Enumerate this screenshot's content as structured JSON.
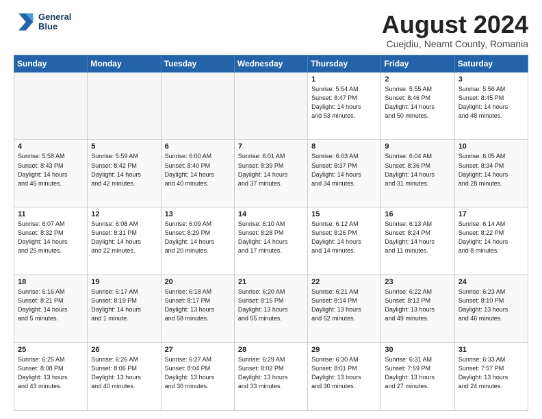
{
  "header": {
    "logo_line1": "General",
    "logo_line2": "Blue",
    "month": "August 2024",
    "location": "Cuejdiu, Neamt County, Romania"
  },
  "weekdays": [
    "Sunday",
    "Monday",
    "Tuesday",
    "Wednesday",
    "Thursday",
    "Friday",
    "Saturday"
  ],
  "weeks": [
    [
      {
        "day": "",
        "info": ""
      },
      {
        "day": "",
        "info": ""
      },
      {
        "day": "",
        "info": ""
      },
      {
        "day": "",
        "info": ""
      },
      {
        "day": "1",
        "info": "Sunrise: 5:54 AM\nSunset: 8:47 PM\nDaylight: 14 hours\nand 53 minutes."
      },
      {
        "day": "2",
        "info": "Sunrise: 5:55 AM\nSunset: 8:46 PM\nDaylight: 14 hours\nand 50 minutes."
      },
      {
        "day": "3",
        "info": "Sunrise: 5:56 AM\nSunset: 8:45 PM\nDaylight: 14 hours\nand 48 minutes."
      }
    ],
    [
      {
        "day": "4",
        "info": "Sunrise: 5:58 AM\nSunset: 8:43 PM\nDaylight: 14 hours\nand 45 minutes."
      },
      {
        "day": "5",
        "info": "Sunrise: 5:59 AM\nSunset: 8:42 PM\nDaylight: 14 hours\nand 42 minutes."
      },
      {
        "day": "6",
        "info": "Sunrise: 6:00 AM\nSunset: 8:40 PM\nDaylight: 14 hours\nand 40 minutes."
      },
      {
        "day": "7",
        "info": "Sunrise: 6:01 AM\nSunset: 8:39 PM\nDaylight: 14 hours\nand 37 minutes."
      },
      {
        "day": "8",
        "info": "Sunrise: 6:03 AM\nSunset: 8:37 PM\nDaylight: 14 hours\nand 34 minutes."
      },
      {
        "day": "9",
        "info": "Sunrise: 6:04 AM\nSunset: 8:36 PM\nDaylight: 14 hours\nand 31 minutes."
      },
      {
        "day": "10",
        "info": "Sunrise: 6:05 AM\nSunset: 8:34 PM\nDaylight: 14 hours\nand 28 minutes."
      }
    ],
    [
      {
        "day": "11",
        "info": "Sunrise: 6:07 AM\nSunset: 8:32 PM\nDaylight: 14 hours\nand 25 minutes."
      },
      {
        "day": "12",
        "info": "Sunrise: 6:08 AM\nSunset: 8:31 PM\nDaylight: 14 hours\nand 22 minutes."
      },
      {
        "day": "13",
        "info": "Sunrise: 6:09 AM\nSunset: 8:29 PM\nDaylight: 14 hours\nand 20 minutes."
      },
      {
        "day": "14",
        "info": "Sunrise: 6:10 AM\nSunset: 8:28 PM\nDaylight: 14 hours\nand 17 minutes."
      },
      {
        "day": "15",
        "info": "Sunrise: 6:12 AM\nSunset: 8:26 PM\nDaylight: 14 hours\nand 14 minutes."
      },
      {
        "day": "16",
        "info": "Sunrise: 6:13 AM\nSunset: 8:24 PM\nDaylight: 14 hours\nand 11 minutes."
      },
      {
        "day": "17",
        "info": "Sunrise: 6:14 AM\nSunset: 8:22 PM\nDaylight: 14 hours\nand 8 minutes."
      }
    ],
    [
      {
        "day": "18",
        "info": "Sunrise: 6:16 AM\nSunset: 8:21 PM\nDaylight: 14 hours\nand 5 minutes."
      },
      {
        "day": "19",
        "info": "Sunrise: 6:17 AM\nSunset: 8:19 PM\nDaylight: 14 hours\nand 1 minute."
      },
      {
        "day": "20",
        "info": "Sunrise: 6:18 AM\nSunset: 8:17 PM\nDaylight: 13 hours\nand 58 minutes."
      },
      {
        "day": "21",
        "info": "Sunrise: 6:20 AM\nSunset: 8:15 PM\nDaylight: 13 hours\nand 55 minutes."
      },
      {
        "day": "22",
        "info": "Sunrise: 6:21 AM\nSunset: 8:14 PM\nDaylight: 13 hours\nand 52 minutes."
      },
      {
        "day": "23",
        "info": "Sunrise: 6:22 AM\nSunset: 8:12 PM\nDaylight: 13 hours\nand 49 minutes."
      },
      {
        "day": "24",
        "info": "Sunrise: 6:23 AM\nSunset: 8:10 PM\nDaylight: 13 hours\nand 46 minutes."
      }
    ],
    [
      {
        "day": "25",
        "info": "Sunrise: 6:25 AM\nSunset: 8:08 PM\nDaylight: 13 hours\nand 43 minutes."
      },
      {
        "day": "26",
        "info": "Sunrise: 6:26 AM\nSunset: 8:06 PM\nDaylight: 13 hours\nand 40 minutes."
      },
      {
        "day": "27",
        "info": "Sunrise: 6:27 AM\nSunset: 8:04 PM\nDaylight: 13 hours\nand 36 minutes."
      },
      {
        "day": "28",
        "info": "Sunrise: 6:29 AM\nSunset: 8:02 PM\nDaylight: 13 hours\nand 33 minutes."
      },
      {
        "day": "29",
        "info": "Sunrise: 6:30 AM\nSunset: 8:01 PM\nDaylight: 13 hours\nand 30 minutes."
      },
      {
        "day": "30",
        "info": "Sunrise: 6:31 AM\nSunset: 7:59 PM\nDaylight: 13 hours\nand 27 minutes."
      },
      {
        "day": "31",
        "info": "Sunrise: 6:33 AM\nSunset: 7:57 PM\nDaylight: 13 hours\nand 24 minutes."
      }
    ]
  ]
}
